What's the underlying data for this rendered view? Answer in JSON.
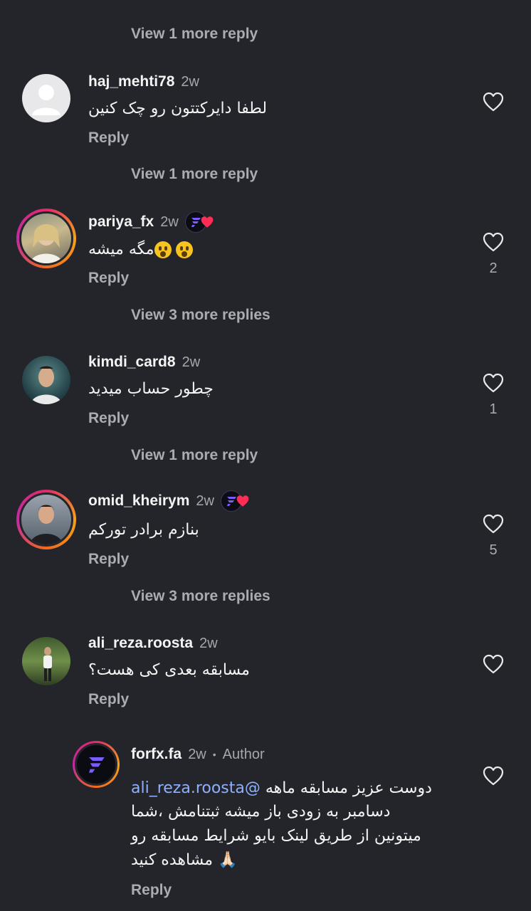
{
  "thread": {
    "view_more_top": "View 1 more reply"
  },
  "comments": [
    {
      "username": "haj_mehti78",
      "time": "2w",
      "text": "لطفا دایرکتتون رو چک کنین",
      "reply": "Reply",
      "likes": "",
      "view_more": "View 1 more reply"
    },
    {
      "username": "pariya_fx",
      "time": "2w",
      "text": "مگه میشه",
      "reply": "Reply",
      "likes": "2",
      "view_more": "View 3 more replies"
    },
    {
      "username": "kimdi_card8",
      "time": "2w",
      "text": "چطور حساب میدید",
      "reply": "Reply",
      "likes": "1",
      "view_more": "View 1 more reply"
    },
    {
      "username": "omid_kheirym",
      "time": "2w",
      "text": "بنازم برادر تورکم",
      "reply": "Reply",
      "likes": "5",
      "view_more": "View 3 more replies"
    },
    {
      "username": "ali_reza.roosta",
      "time": "2w",
      "text": "مسابقه بعدی کی هست؟",
      "reply": "Reply",
      "likes": ""
    }
  ],
  "author_reply": {
    "username": "forfx.fa",
    "time": "2w",
    "separator": "•",
    "tag": "Author",
    "mention": "@ali_reza.roosta",
    "line1": "دوست عزیز مسابقه ماهه",
    "line2": "دسامبر به زودی باز میشه ثبتنامش ،شما",
    "line3": "میتونین از طریق لینک بایو شرایط مسابقه رو",
    "line4": "مشاهده کنید",
    "emoji": "🙏🏻",
    "reply": "Reply"
  },
  "colors": {
    "background": "#23252a",
    "muted": "#a9acb2",
    "mention": "#8fb0ff",
    "heart_badge": "#ff2d55"
  }
}
